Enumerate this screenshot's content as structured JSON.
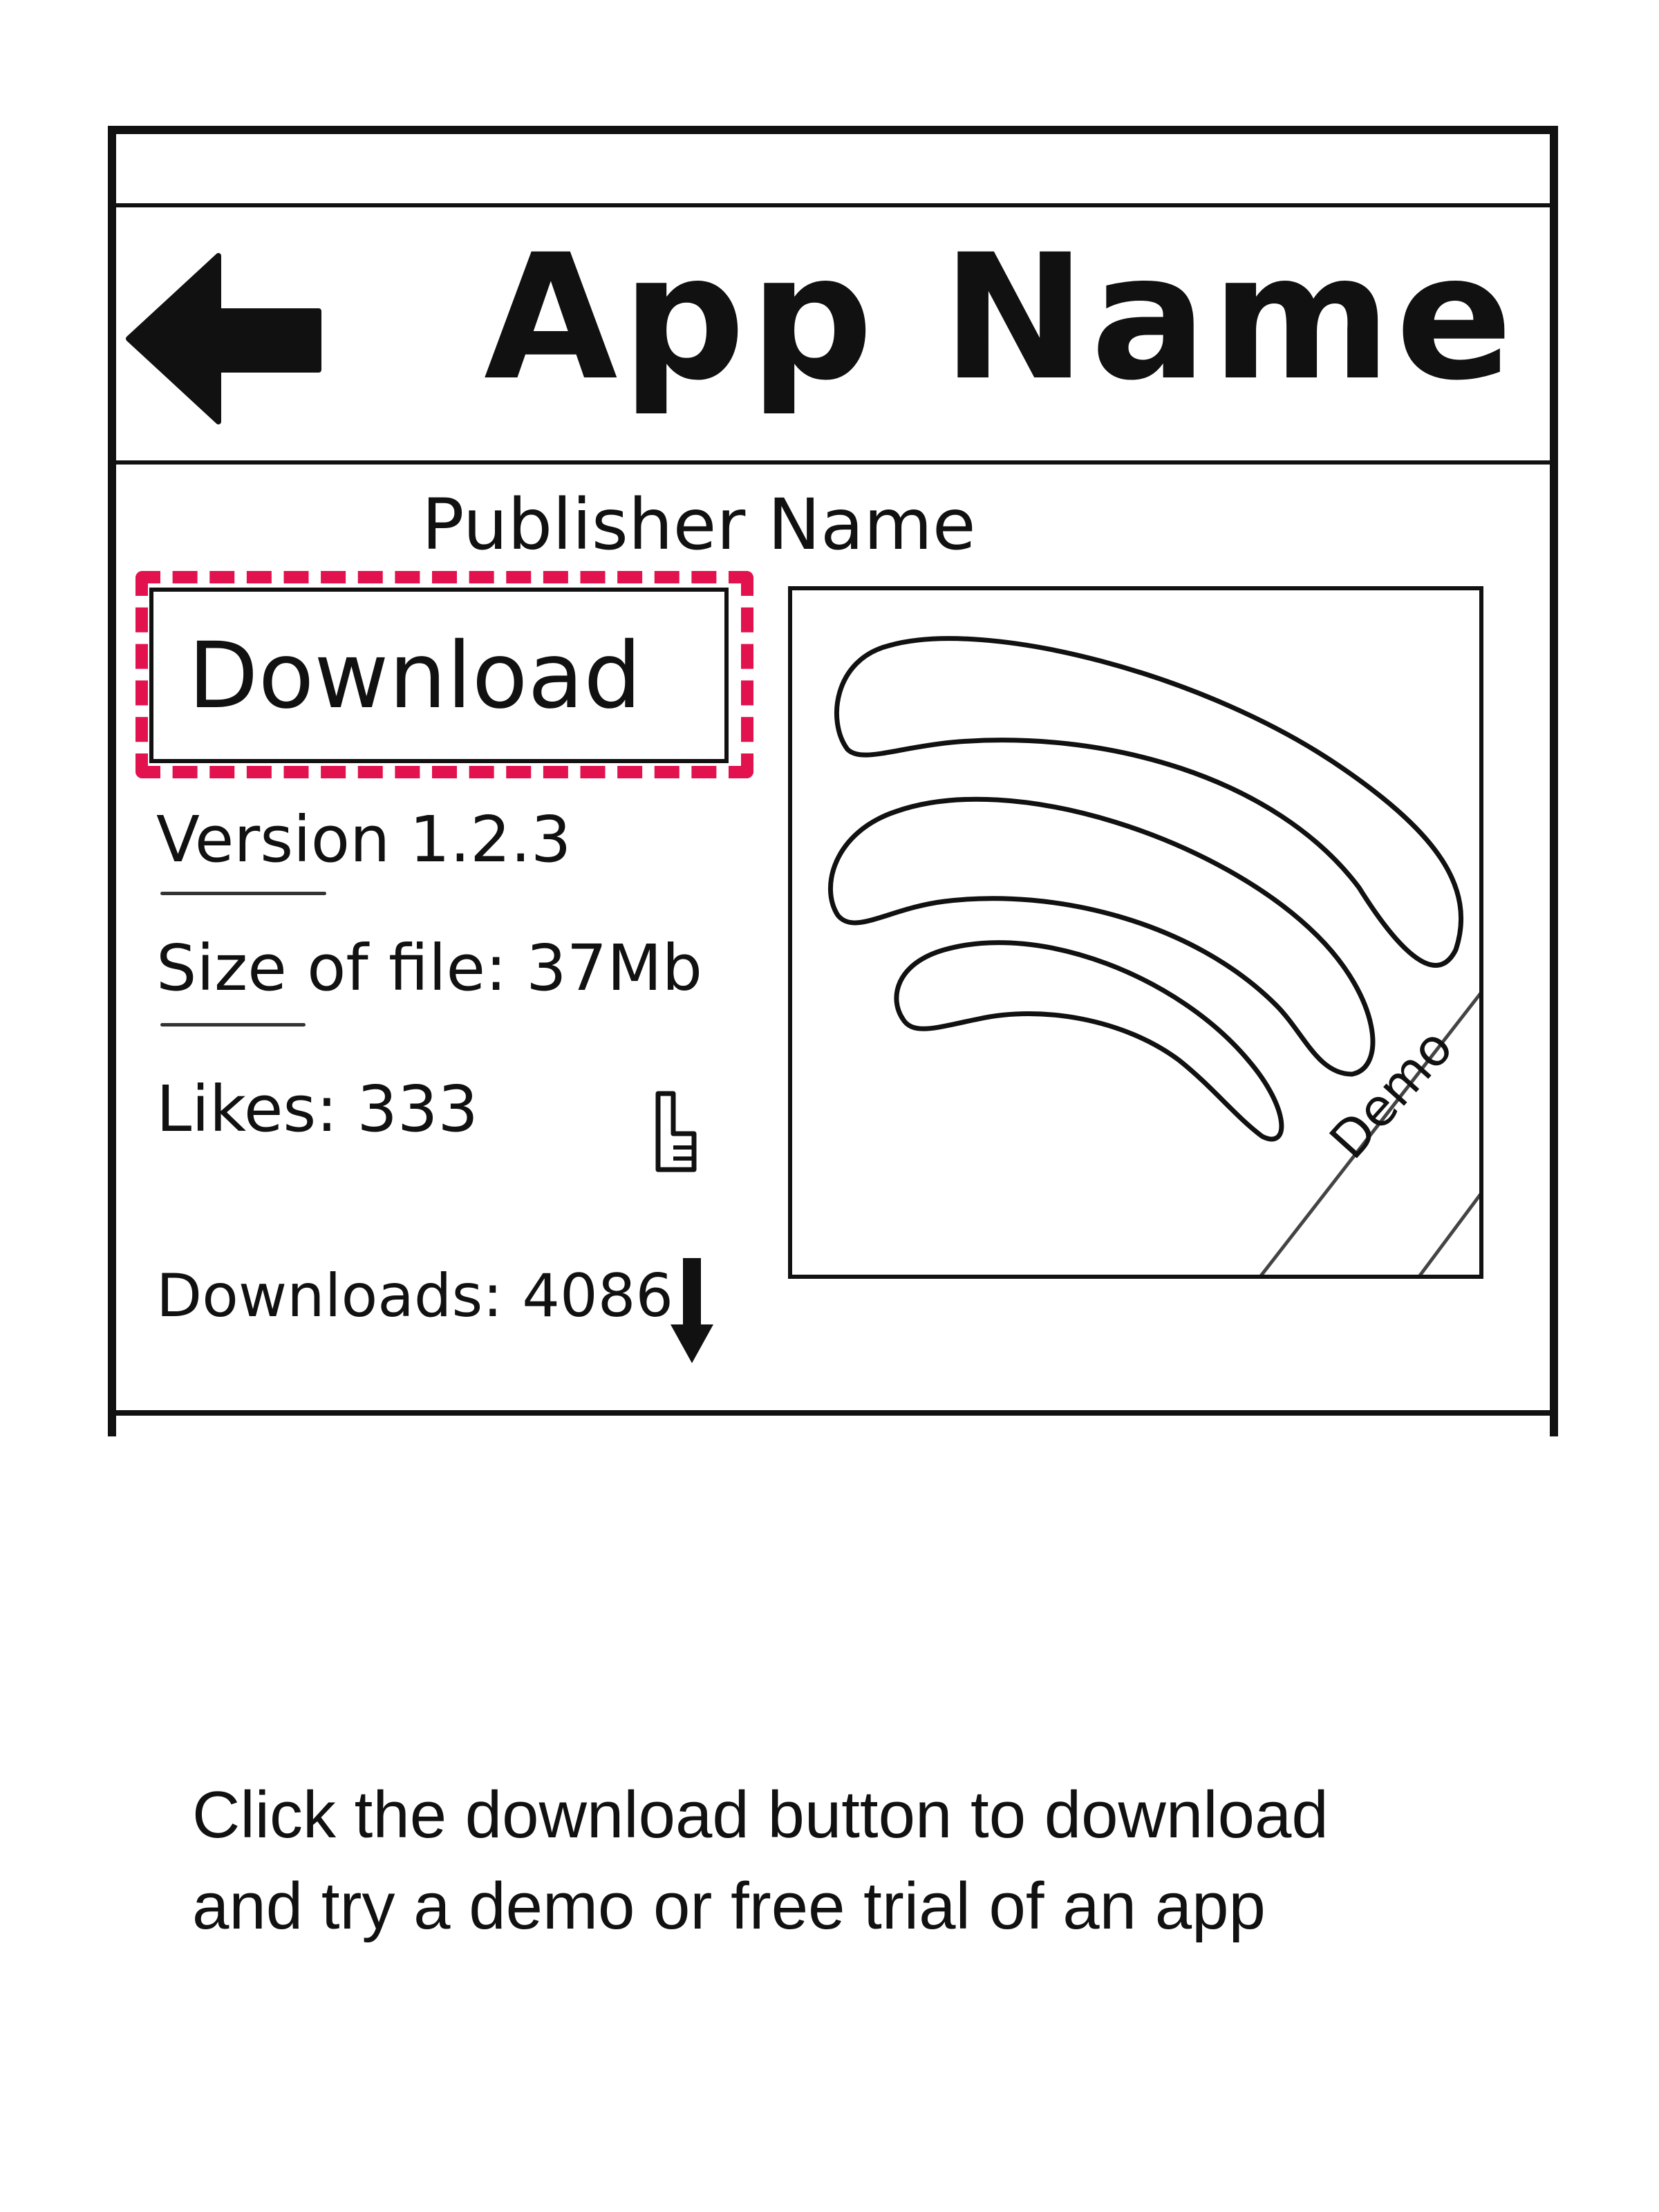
{
  "header": {
    "title": "App Name",
    "back_icon": "arrow-left-icon"
  },
  "details": {
    "publisher": "Publisher Name",
    "download_label": "Download",
    "version_label": "Version",
    "version_value": "1.2.3",
    "size_label": "Size of file:",
    "size_value": "37Mb",
    "likes_label": "Likes:",
    "likes_value": "333",
    "likes_icon": "thumbs-up-icon",
    "downloads_label": "Downloads:",
    "downloads_value": "4086",
    "downloads_icon": "arrow-down-icon"
  },
  "preview": {
    "badge": "Demo",
    "icon": "wifi-waves-icon"
  },
  "caption": {
    "line1": "Click the download button to download",
    "line2": "and try a demo or free trial of an app"
  },
  "colors": {
    "highlight": "#e2124f",
    "ink": "#111111"
  }
}
